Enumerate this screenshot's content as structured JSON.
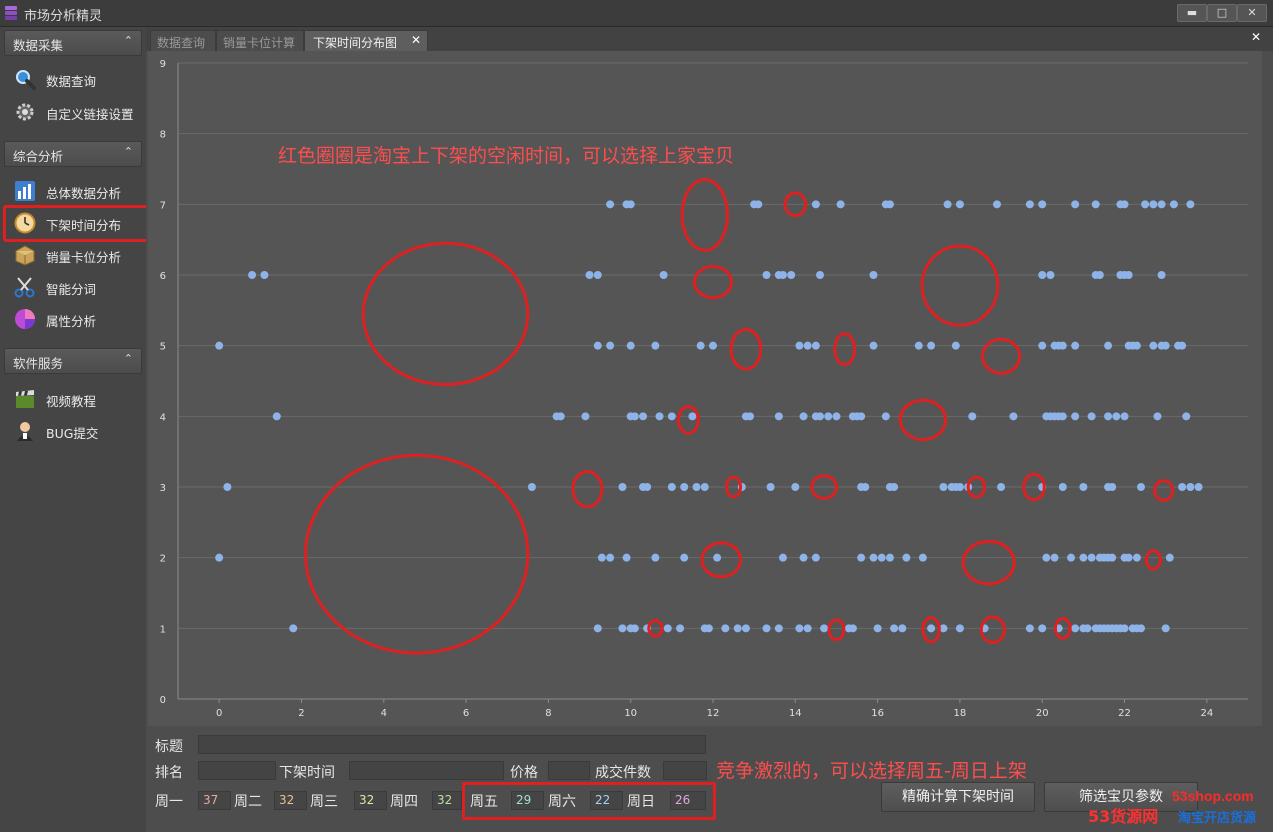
{
  "window": {
    "title": "市场分析精灵",
    "buttons": {
      "minimize": "▬",
      "maximize": "□",
      "close": "✕"
    }
  },
  "sidebar": {
    "sections": [
      {
        "label": "数据采集",
        "items": [
          {
            "label": "数据查询",
            "icon": "magnifier-icon"
          },
          {
            "label": "自定义链接设置",
            "icon": "gear-icon"
          }
        ]
      },
      {
        "label": "综合分析",
        "items": [
          {
            "label": "总体数据分析",
            "icon": "bar-chart-icon"
          },
          {
            "label": "下架时间分布",
            "icon": "clock-icon"
          },
          {
            "label": "销量卡位分析",
            "icon": "box-icon"
          },
          {
            "label": "智能分词",
            "icon": "scissors-icon"
          },
          {
            "label": "属性分析",
            "icon": "pie-chart-icon"
          }
        ]
      },
      {
        "label": "软件服务",
        "items": [
          {
            "label": "视频教程",
            "icon": "clapper-icon"
          },
          {
            "label": "BUG提交",
            "icon": "user-icon"
          }
        ]
      }
    ],
    "chevron": "⌃"
  },
  "tabs": [
    {
      "label": "数据查询",
      "active": false
    },
    {
      "label": "销量卡位计算",
      "active": false
    },
    {
      "label": "下架时间分布图",
      "active": true
    }
  ],
  "tab_close": "✕",
  "panel_close": "✕",
  "chart_data": {
    "type": "scatter",
    "xlim": [
      -1,
      25
    ],
    "ylim": [
      0,
      9
    ],
    "xticks": [
      0,
      2,
      4,
      6,
      8,
      10,
      12,
      14,
      16,
      18,
      20,
      22,
      24
    ],
    "yticks": [
      0,
      1,
      2,
      3,
      4,
      5,
      6,
      7,
      8,
      9
    ],
    "grid": true,
    "point_color": "#8db3e8",
    "circle_color": "#e02020",
    "points": {
      "7": [
        9.5,
        9.9,
        10.0,
        13.0,
        13.1,
        14.5,
        15.1,
        16.2,
        16.3,
        17.7,
        18.0,
        18.9,
        19.7,
        20.0,
        20.8,
        21.3,
        21.9,
        22.0,
        22.5,
        22.7,
        22.9,
        23.2,
        23.6
      ],
      "6": [
        0.8,
        1.1,
        9.0,
        9.2,
        10.8,
        13.3,
        13.6,
        13.7,
        13.9,
        14.6,
        15.9,
        20.0,
        20.2,
        21.3,
        21.4,
        21.9,
        22.0,
        22.1,
        22.9
      ],
      "5": [
        0.0,
        9.2,
        9.5,
        10.0,
        10.6,
        11.7,
        12.0,
        14.1,
        14.3,
        14.5,
        15.9,
        17.0,
        17.3,
        17.9,
        20.0,
        20.3,
        20.4,
        20.5,
        20.8,
        21.6,
        22.1,
        22.2,
        22.3,
        22.7,
        22.9,
        23.0,
        23.3,
        23.4
      ],
      "4": [
        1.4,
        8.2,
        8.3,
        8.9,
        10.0,
        10.1,
        10.3,
        10.7,
        11.0,
        11.5,
        12.8,
        12.9,
        13.6,
        14.2,
        14.5,
        14.6,
        14.8,
        15.0,
        15.4,
        15.5,
        15.6,
        16.2,
        18.3,
        19.3,
        20.1,
        20.2,
        20.3,
        20.4,
        20.5,
        20.8,
        21.2,
        21.6,
        21.8,
        22.0,
        22.8,
        23.5
      ],
      "3": [
        0.2,
        7.6,
        9.8,
        10.3,
        10.4,
        11.0,
        11.3,
        11.6,
        11.8,
        12.7,
        13.4,
        14.0,
        15.6,
        15.7,
        16.3,
        16.4,
        17.6,
        17.8,
        17.9,
        18.0,
        18.2,
        19.0,
        20.0,
        20.5,
        21.0,
        21.6,
        21.7,
        22.4,
        23.4,
        23.6,
        23.8
      ],
      "2": [
        0.0,
        9.3,
        9.5,
        9.9,
        10.6,
        11.3,
        12.1,
        13.7,
        14.2,
        14.5,
        15.6,
        15.9,
        16.1,
        16.3,
        16.7,
        17.1,
        20.1,
        20.3,
        20.7,
        21.0,
        21.2,
        21.4,
        21.5,
        21.6,
        21.7,
        22.0,
        22.1,
        22.3,
        23.1
      ],
      "1": [
        1.8,
        9.2,
        9.8,
        10.0,
        10.1,
        10.4,
        10.9,
        11.2,
        11.8,
        11.9,
        12.3,
        12.6,
        12.8,
        13.3,
        13.6,
        14.1,
        14.3,
        14.7,
        15.3,
        15.4,
        16.0,
        16.4,
        16.6,
        17.3,
        17.6,
        18.0,
        18.6,
        19.7,
        20.0,
        20.4,
        20.8,
        21.0,
        21.1,
        21.3,
        21.4,
        21.5,
        21.6,
        21.7,
        21.8,
        21.9,
        22.0,
        22.2,
        22.3,
        22.4,
        23.0
      ]
    },
    "circles": [
      {
        "cx": 5.5,
        "cy": 5.45,
        "rx": 2.0,
        "ry": 1.0
      },
      {
        "cx": 4.8,
        "cy": 2.05,
        "rx": 2.7,
        "ry": 1.4
      },
      {
        "cx": 11.8,
        "cy": 6.85,
        "rx": 0.55,
        "ry": 0.5
      },
      {
        "cx": 14.0,
        "cy": 7.0,
        "rx": 0.25,
        "ry": 0.16
      },
      {
        "cx": 12.0,
        "cy": 5.9,
        "rx": 0.45,
        "ry": 0.22
      },
      {
        "cx": 18.0,
        "cy": 5.85,
        "rx": 0.92,
        "ry": 0.56
      },
      {
        "cx": 12.8,
        "cy": 4.95,
        "rx": 0.36,
        "ry": 0.28
      },
      {
        "cx": 15.2,
        "cy": 4.95,
        "rx": 0.24,
        "ry": 0.22
      },
      {
        "cx": 19.0,
        "cy": 4.85,
        "rx": 0.45,
        "ry": 0.24
      },
      {
        "cx": 11.4,
        "cy": 3.95,
        "rx": 0.24,
        "ry": 0.19
      },
      {
        "cx": 17.1,
        "cy": 3.95,
        "rx": 0.55,
        "ry": 0.28
      },
      {
        "cx": 8.95,
        "cy": 2.97,
        "rx": 0.35,
        "ry": 0.25
      },
      {
        "cx": 12.5,
        "cy": 3.0,
        "rx": 0.17,
        "ry": 0.14
      },
      {
        "cx": 14.7,
        "cy": 3.0,
        "rx": 0.3,
        "ry": 0.16
      },
      {
        "cx": 18.4,
        "cy": 3.0,
        "rx": 0.2,
        "ry": 0.14
      },
      {
        "cx": 19.8,
        "cy": 3.0,
        "rx": 0.25,
        "ry": 0.18
      },
      {
        "cx": 22.95,
        "cy": 2.95,
        "rx": 0.22,
        "ry": 0.14
      },
      {
        "cx": 12.2,
        "cy": 1.97,
        "rx": 0.47,
        "ry": 0.24
      },
      {
        "cx": 18.7,
        "cy": 1.93,
        "rx": 0.62,
        "ry": 0.3
      },
      {
        "cx": 22.7,
        "cy": 1.97,
        "rx": 0.17,
        "ry": 0.13
      },
      {
        "cx": 10.6,
        "cy": 1.0,
        "rx": 0.16,
        "ry": 0.11
      },
      {
        "cx": 15.0,
        "cy": 0.98,
        "rx": 0.18,
        "ry": 0.14
      },
      {
        "cx": 17.3,
        "cy": 0.98,
        "rx": 0.2,
        "ry": 0.17
      },
      {
        "cx": 18.8,
        "cy": 0.98,
        "rx": 0.28,
        "ry": 0.18
      },
      {
        "cx": 20.5,
        "cy": 1.0,
        "rx": 0.18,
        "ry": 0.14
      }
    ],
    "annotations": [
      {
        "text": "红色圈圈是淘宝上下架的空闲时间，可以选择上家宝贝"
      }
    ]
  },
  "form": {
    "title_label": "标题",
    "rank_label": "排名",
    "delist_time_label": "下架时间",
    "price_label": "价格",
    "deals_label": "成交件数",
    "days": [
      {
        "label": "周一",
        "value": "37",
        "color": "#e8a9a0"
      },
      {
        "label": "周二",
        "value": "32",
        "color": "#e8c090"
      },
      {
        "label": "周三",
        "value": "32",
        "color": "#e6e3a0"
      },
      {
        "label": "周四",
        "value": "32",
        "color": "#b8e0a0"
      },
      {
        "label": "周五",
        "value": "29",
        "color": "#a0e0d0"
      },
      {
        "label": "周六",
        "value": "22",
        "color": "#a8d0f0"
      },
      {
        "label": "周日",
        "value": "26",
        "color": "#e0a8e0"
      }
    ],
    "calc_button": "精确计算下架时间",
    "filter_button": "筛选宝贝参数",
    "annotation": "竞争激烈的，可以选择周五-周日上架"
  },
  "watermark": {
    "line1": "53货源网",
    "url": "53shop.com",
    "line2": "淘宝开店货源"
  }
}
